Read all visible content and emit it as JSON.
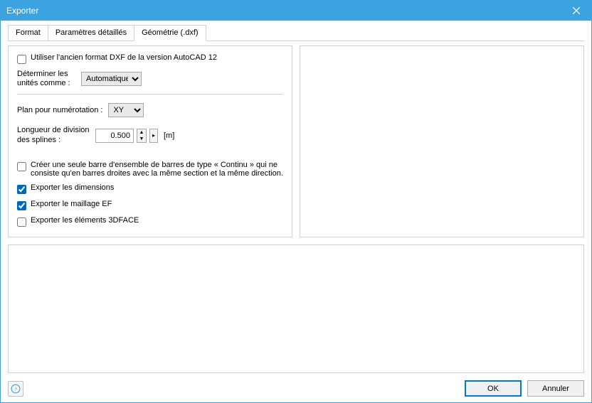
{
  "window": {
    "title": "Exporter"
  },
  "tabs": {
    "format": "Format",
    "detailed": "Paramètres détaillés",
    "geometry": "Géométrie (.dxf)"
  },
  "left": {
    "old_dxf_label": "Utiliser l'ancien format DXF de la version AutoCAD 12",
    "units_label": "Déterminer les unités comme :",
    "units_value": "Automatique",
    "plane_label": "Plan pour numérotation :",
    "plane_value": "XY",
    "spline_label": "Longueur de division des splines :",
    "spline_value": "0.500",
    "spline_unit": "[m]",
    "single_bar_label": "Créer une seule barre d'ensemble de barres de type « Continu » qui ne consiste qu'en barres droites avec la même section et la même direction.",
    "export_dim_label": "Exporter les dimensions",
    "export_mesh_label": "Exporter le maillage EF",
    "export_3dface_label": "Exporter les éléments 3DFACE"
  },
  "footer": {
    "ok": "OK",
    "cancel": "Annuler"
  }
}
